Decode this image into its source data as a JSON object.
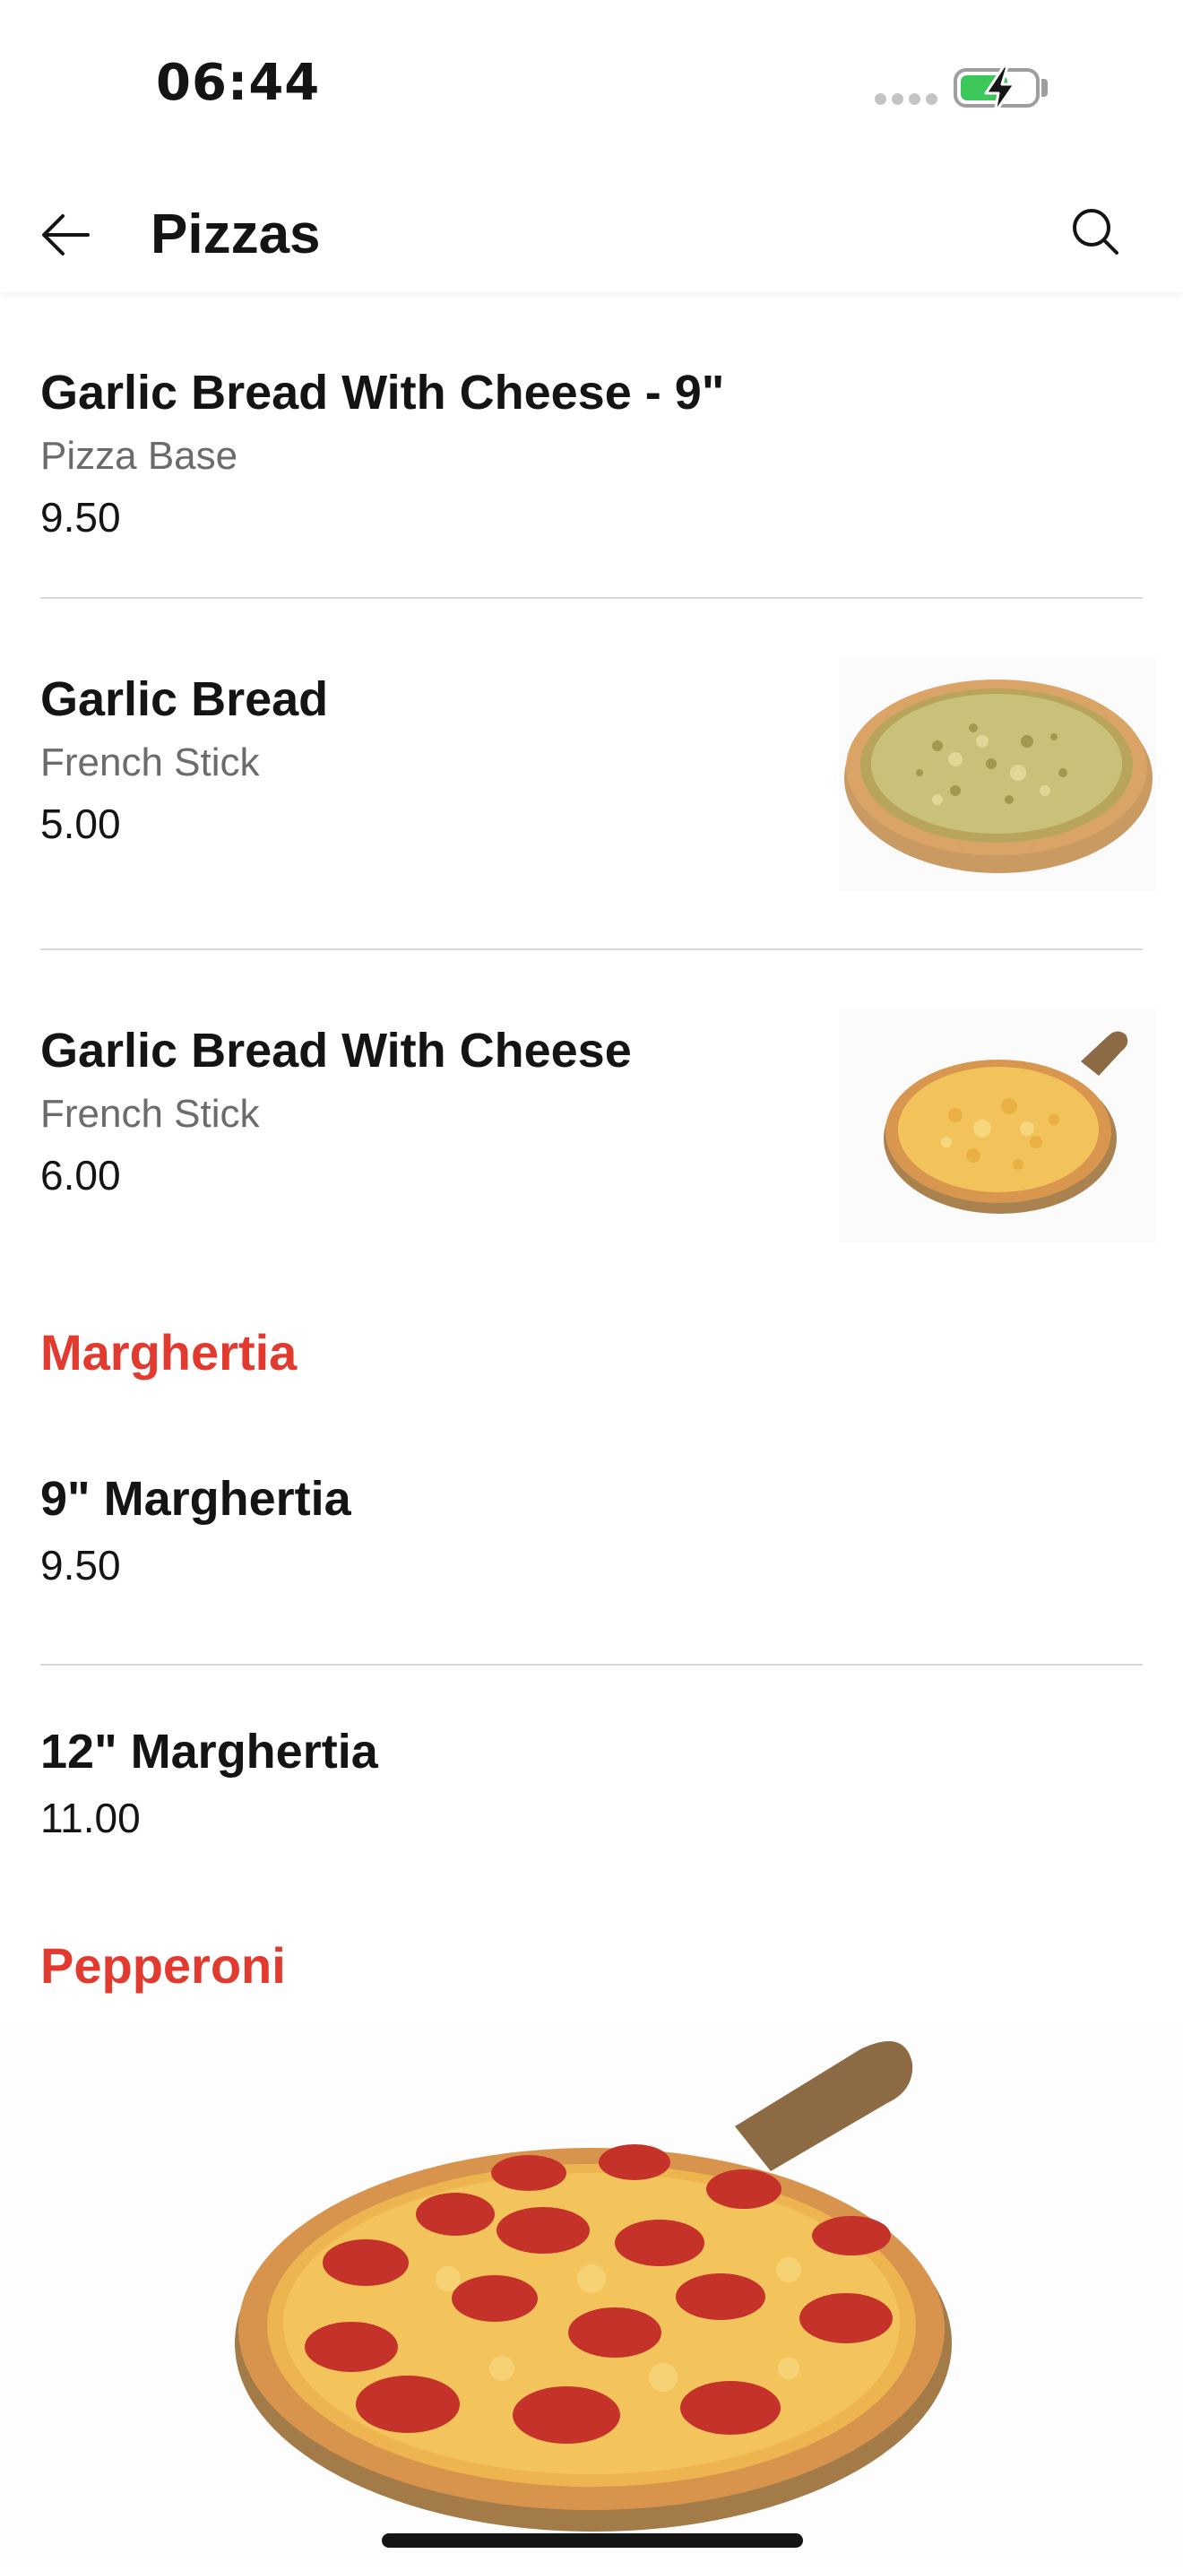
{
  "status_bar": {
    "time": "06:44"
  },
  "app_bar": {
    "title": "Pizzas"
  },
  "items": [
    {
      "name": "Garlic Bread With Cheese - 9\"",
      "subtitle": "Pizza Base",
      "price": "9.50"
    },
    {
      "name": "Garlic Bread",
      "subtitle": "French Stick",
      "price": "5.00"
    },
    {
      "name": "Garlic Bread With Cheese",
      "subtitle": "French Stick",
      "price": "6.00"
    }
  ],
  "sections": [
    {
      "title": "Marghertia",
      "items": [
        {
          "name": "9\" Marghertia",
          "price": "9.50"
        },
        {
          "name": "12\" Marghertia",
          "price": "11.00"
        }
      ]
    },
    {
      "title": "Pepperoni"
    }
  ],
  "colors": {
    "accent": "#e23a2f",
    "text": "#141414",
    "muted": "#6b6b6b",
    "battery": "#3cc75a"
  },
  "icons": [
    "back-arrow-icon",
    "search-icon",
    "battery-charging-icon",
    "signal-icon"
  ]
}
